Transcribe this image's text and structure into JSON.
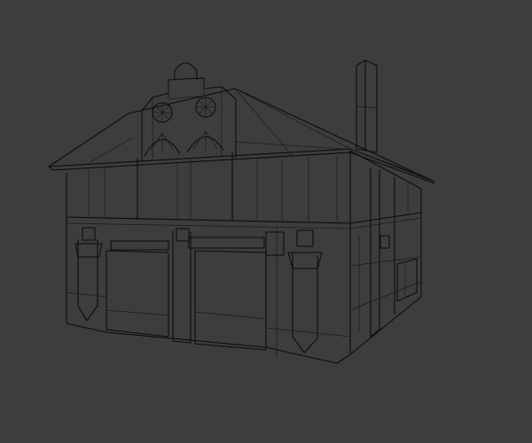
{
  "viewport": {
    "background_color": "#3d3d3d",
    "wire_color": "#0c0c0c"
  }
}
